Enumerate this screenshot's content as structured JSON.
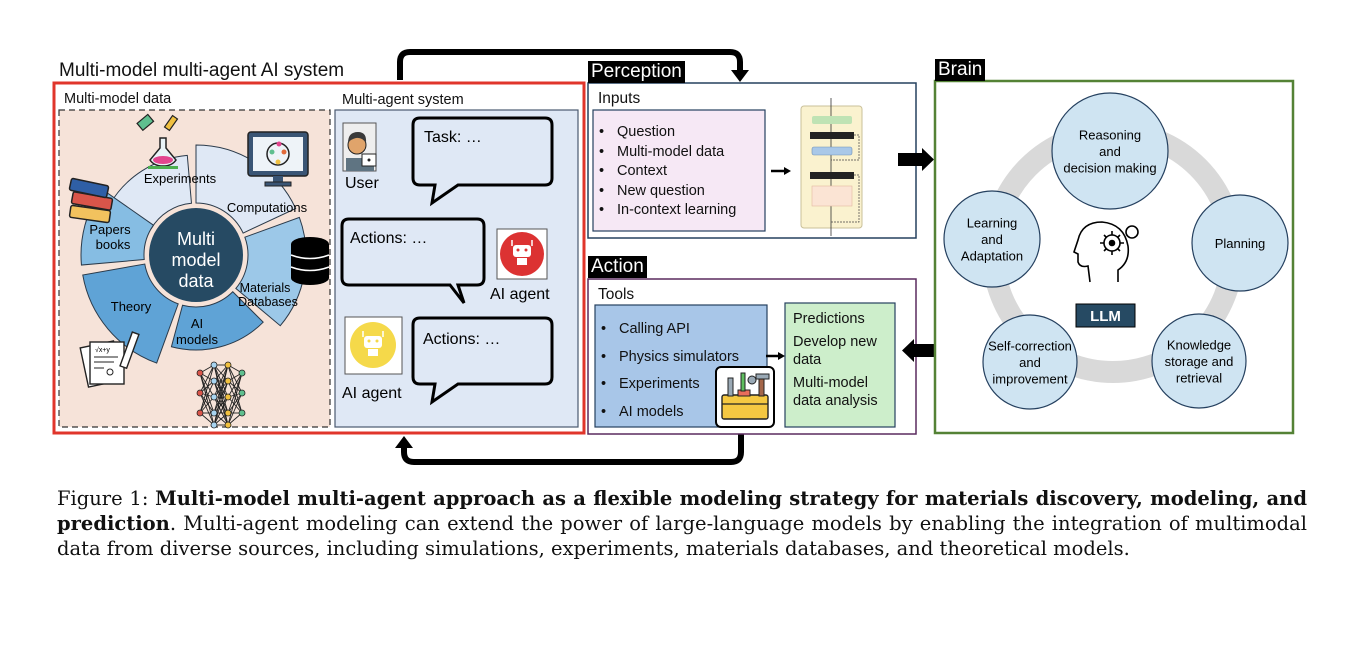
{
  "system": {
    "title": "Multi-model multi-agent AI system",
    "color": "#e0352b"
  },
  "multi_model_data": {
    "title": "Multi-model data",
    "center": [
      "Multi",
      "model",
      "data"
    ],
    "segments": [
      {
        "label": [
          "Experiments"
        ],
        "icon": "chemistry-flask-icon"
      },
      {
        "label": [
          "Computations"
        ],
        "icon": "computer-monitor-icon"
      },
      {
        "label": [
          "Materials",
          "Databases"
        ],
        "icon": "database-icon"
      },
      {
        "label": [
          "AI",
          "models"
        ],
        "icon": "neural-network-icon"
      },
      {
        "label": [
          "Theory"
        ],
        "icon": "theory-document-icon"
      },
      {
        "label": [
          "Papers",
          "books"
        ],
        "icon": "books-icon"
      }
    ]
  },
  "multi_agent": {
    "title": "Multi-agent system",
    "user_label": "User",
    "bubbles": [
      "Task: …",
      "Actions: …",
      "Actions: …"
    ],
    "agent_labels": [
      "AI agent",
      "AI agent"
    ],
    "agent_colors": [
      "#dc3232",
      "#f5d94a"
    ]
  },
  "perception": {
    "title": "Perception",
    "inputs_title": "Inputs",
    "inputs": [
      "Question",
      "Multi-model data",
      "Context",
      "New question",
      "In-context learning"
    ]
  },
  "action": {
    "title": "Action",
    "tools_title": "Tools",
    "tools": [
      "Calling API",
      "Physics simulators",
      "Experiments",
      "AI models"
    ],
    "outputs": [
      "Predictions",
      "Develop new data",
      "Multi-model data analysis"
    ]
  },
  "brain": {
    "title": "Brain",
    "center_label": "LLM",
    "nodes": [
      [
        "Reasoning",
        "and",
        "decision making"
      ],
      [
        "Planning"
      ],
      [
        "Knowledge",
        "storage and",
        "retrieval"
      ],
      [
        "Self-correction",
        "and",
        "improvement"
      ],
      [
        "Learning",
        "and",
        "Adaptation"
      ]
    ]
  },
  "caption": {
    "prefix": "Figure 1: ",
    "bold": "Multi-model multi-agent approach as a flexible modeling strategy for materials discovery, modeling, and prediction",
    "rest": ". Multi-agent modeling can extend the power of large-language models by enabling the integration of multimodal data from diverse sources, including simulations, experiments, materials databases, and theoretical models."
  }
}
